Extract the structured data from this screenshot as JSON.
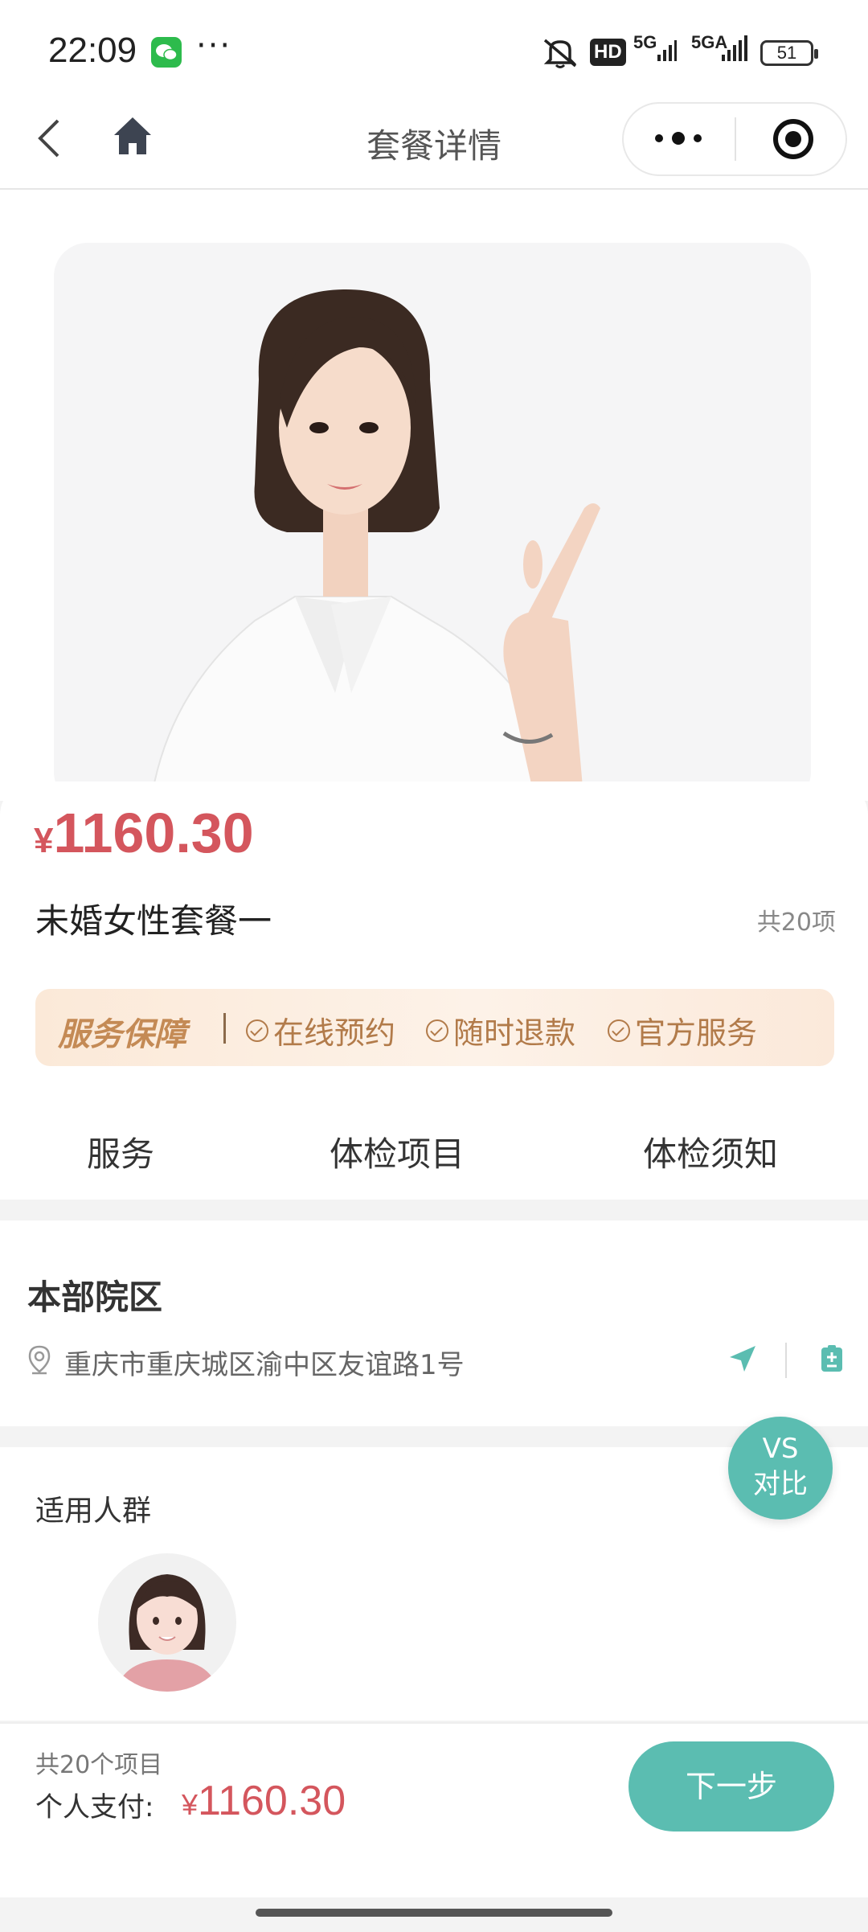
{
  "status_bar": {
    "time": "22:09",
    "more": "···",
    "hd": "HD",
    "net1": "5G",
    "net2": "5GA",
    "battery": "51"
  },
  "nav": {
    "title": "套餐详情"
  },
  "package": {
    "currency": "¥",
    "price": "1160.30",
    "name": "未婚女性套餐一",
    "item_count": "共20项"
  },
  "guarantee": {
    "title": "服务保障",
    "items": [
      "在线预约",
      "随时退款",
      "官方服务"
    ]
  },
  "tabs": [
    "服务",
    "体检项目",
    "体检须知"
  ],
  "campus": {
    "name": "本部院区",
    "address": "重庆市重庆城区渝中区友谊路1号"
  },
  "crowd": {
    "title": "适用人群"
  },
  "compare_button": {
    "line1": "VS",
    "line2": "对比"
  },
  "bottom_bar": {
    "count": "共20个项目",
    "pay_label": "个人支付:",
    "currency": "¥",
    "amount": "1160.30",
    "next_label": "下一步"
  },
  "colors": {
    "price": "#d4565d",
    "accent": "#5bbdb1",
    "guarantee_text": "#b27b4a"
  }
}
